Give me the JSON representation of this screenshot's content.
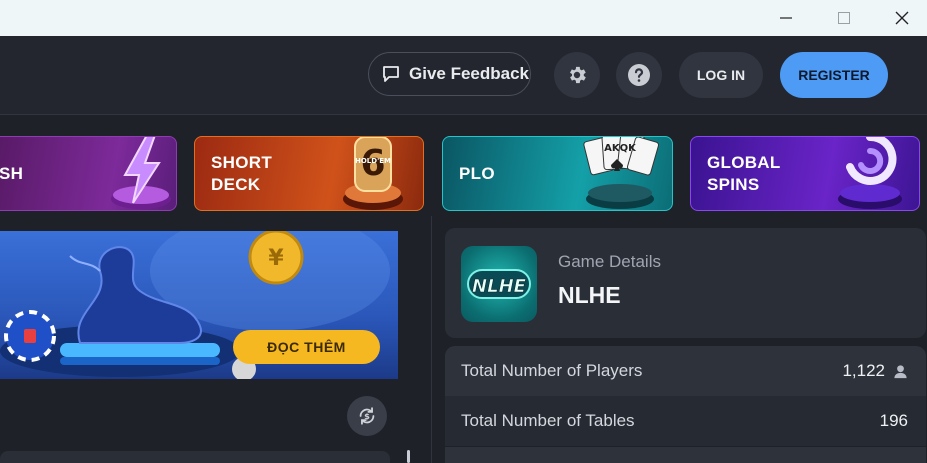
{
  "window": {
    "minimize_icon": "minimize-icon",
    "maximize_icon": "maximize-icon",
    "close_icon": "close-icon"
  },
  "header": {
    "feedback_label": "Give Feedback",
    "login_label": "LOG IN",
    "register_label": "REGISTER",
    "accent": "#4e9bf5"
  },
  "cards": [
    {
      "label": "SH",
      "icon": "lightning-icon"
    },
    {
      "label": "SHORT\nDECK",
      "icon": "six-holdem-icon",
      "art_text": "HOLD'EM"
    },
    {
      "label": "PLO",
      "icon": "playing-cards-icon",
      "art_text": "AKQK"
    },
    {
      "label": "GLOBAL\nSPINS",
      "icon": "spin-icon"
    }
  ],
  "banner": {
    "button_label": "ĐỌC THÊM"
  },
  "details": {
    "section_label": "Game Details",
    "game_name": "NLHE",
    "logo_text": "NLHE",
    "stats": [
      {
        "label": "Total Number of Players",
        "value": "1,122"
      },
      {
        "label": "Total Number of Tables",
        "value": "196"
      }
    ]
  }
}
